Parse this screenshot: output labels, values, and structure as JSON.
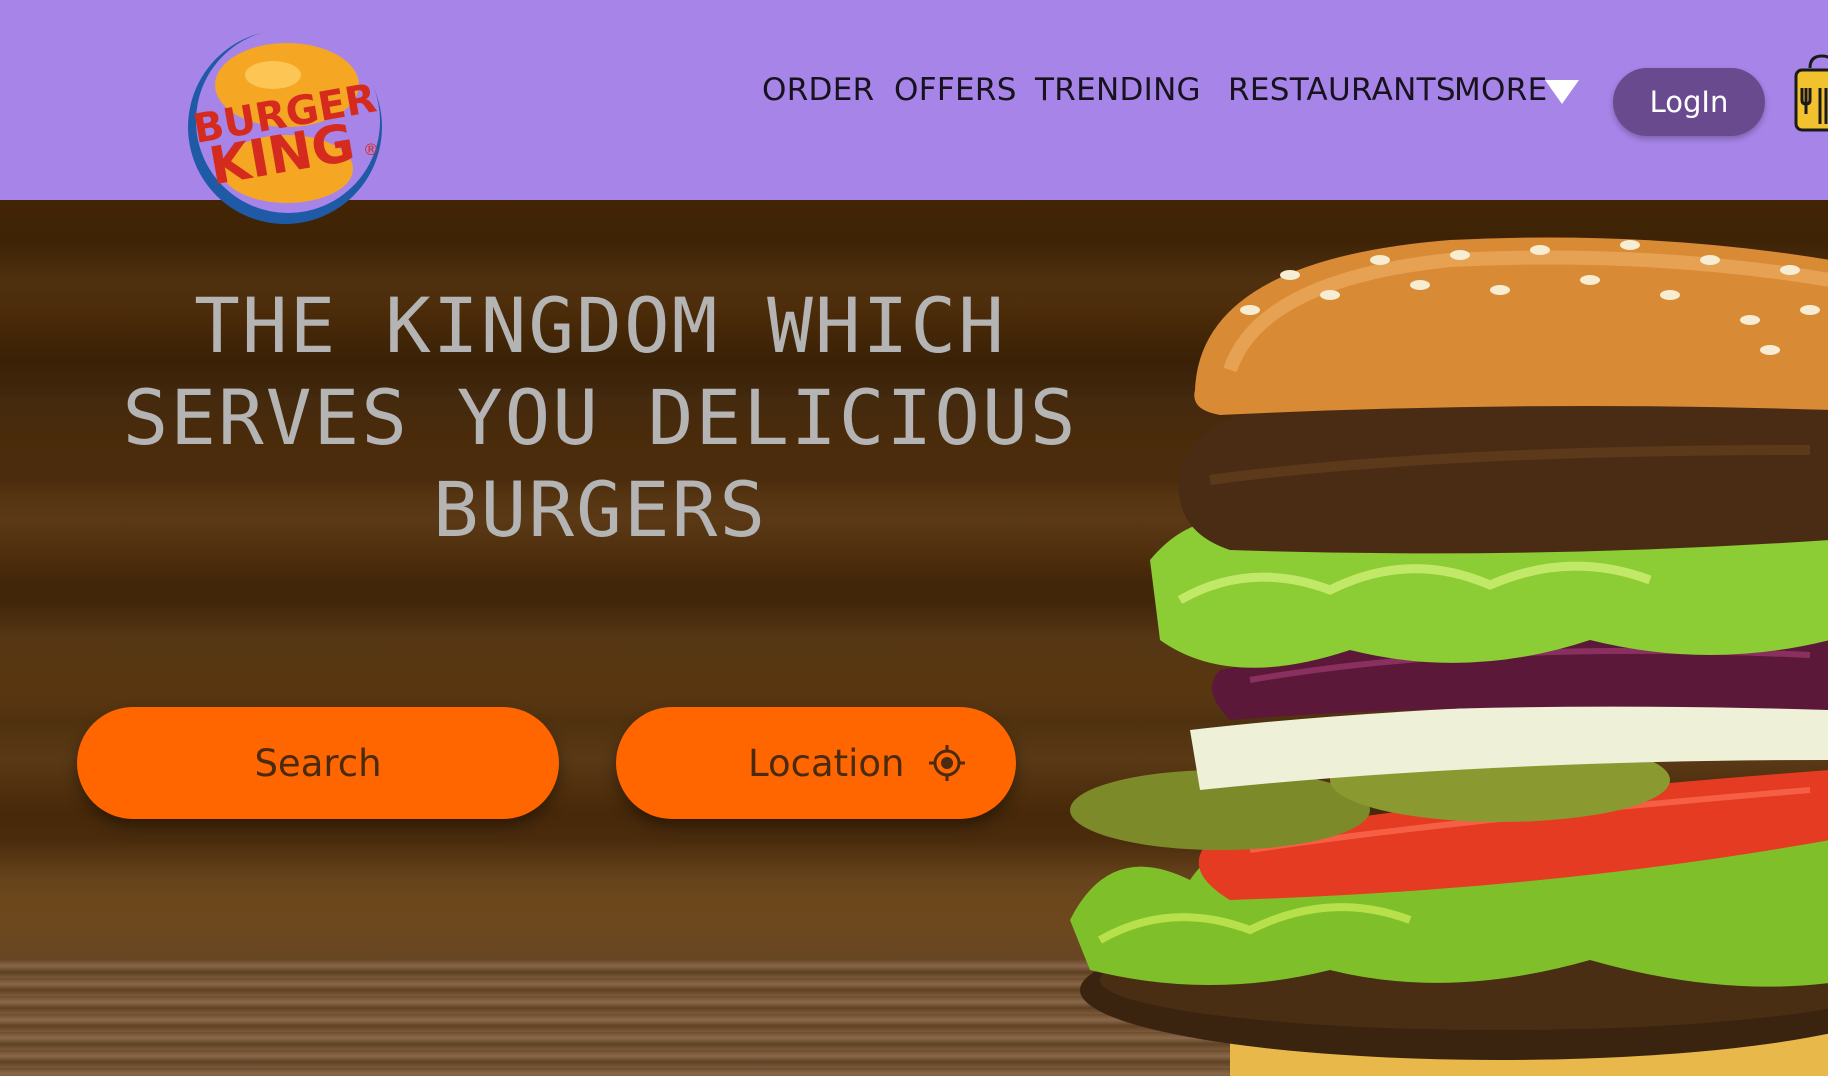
{
  "navbar": {
    "background": "#a784e8",
    "logo": {
      "line1": "BURGER",
      "line2": "KING",
      "mark": "®"
    },
    "links": [
      {
        "label": "ORDER"
      },
      {
        "label": "OFFERS"
      },
      {
        "label": "TRENDING"
      },
      {
        "label": "RESTAURANTS"
      },
      {
        "label": "MORE"
      }
    ],
    "more_icon": "caret-down-icon",
    "login_label": "LogIn",
    "bag_icon": "shopping-bag-icon"
  },
  "hero": {
    "headline_lines": [
      "THE KINGDOM WHICH",
      "SERVES YOU DELICIOUS",
      "BURGERS"
    ],
    "search_label": "Search",
    "location_label": "Location",
    "location_icon": "target-location-icon",
    "button_color": "#ff6600",
    "image": "burger-photo"
  }
}
